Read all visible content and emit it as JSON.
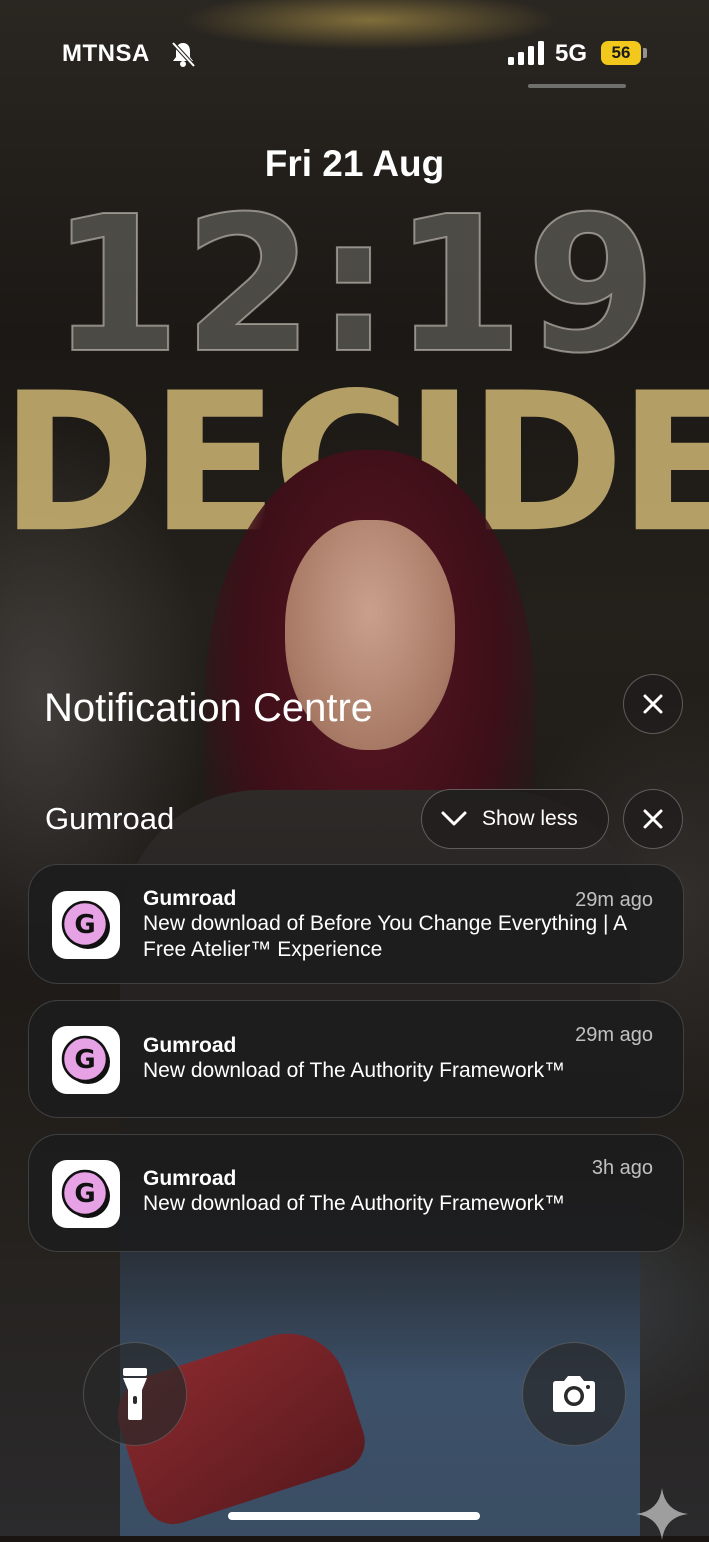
{
  "status_bar": {
    "carrier": "MTNSA",
    "network": "5G",
    "battery": "56",
    "silent_icon": "bell-slash-icon",
    "signal_icon": "cellular-signal-icon"
  },
  "lock_screen": {
    "date": "Fri 21 Aug",
    "time": "12:19"
  },
  "wallpaper": {
    "headline": "DECIDED"
  },
  "notification_centre": {
    "title": "Notification Centre",
    "close_icon": "close-icon",
    "group": {
      "app_name": "Gumroad",
      "show_less_label": "Show less",
      "collapse_icon": "chevron-down-icon",
      "close_icon": "close-icon"
    },
    "notifications": [
      {
        "app": "Gumroad",
        "time": "29m ago",
        "body": "New download of Before You Change Everything | A Free Atelier™ Experience",
        "icon": "gumroad-g-icon"
      },
      {
        "app": "Gumroad",
        "time": "29m ago",
        "body": "New download of The Authority Framework™",
        "icon": "gumroad-g-icon"
      },
      {
        "app": "Gumroad",
        "time": "3h ago",
        "body": "New download of The Authority Framework™",
        "icon": "gumroad-g-icon"
      }
    ]
  },
  "bottom_controls": {
    "flashlight_icon": "flashlight-icon",
    "camera_icon": "camera-icon"
  },
  "colors": {
    "battery": "#f2c81c",
    "gumroad_pink": "#e7a2e6",
    "card_bg": "#1c1c1e"
  }
}
